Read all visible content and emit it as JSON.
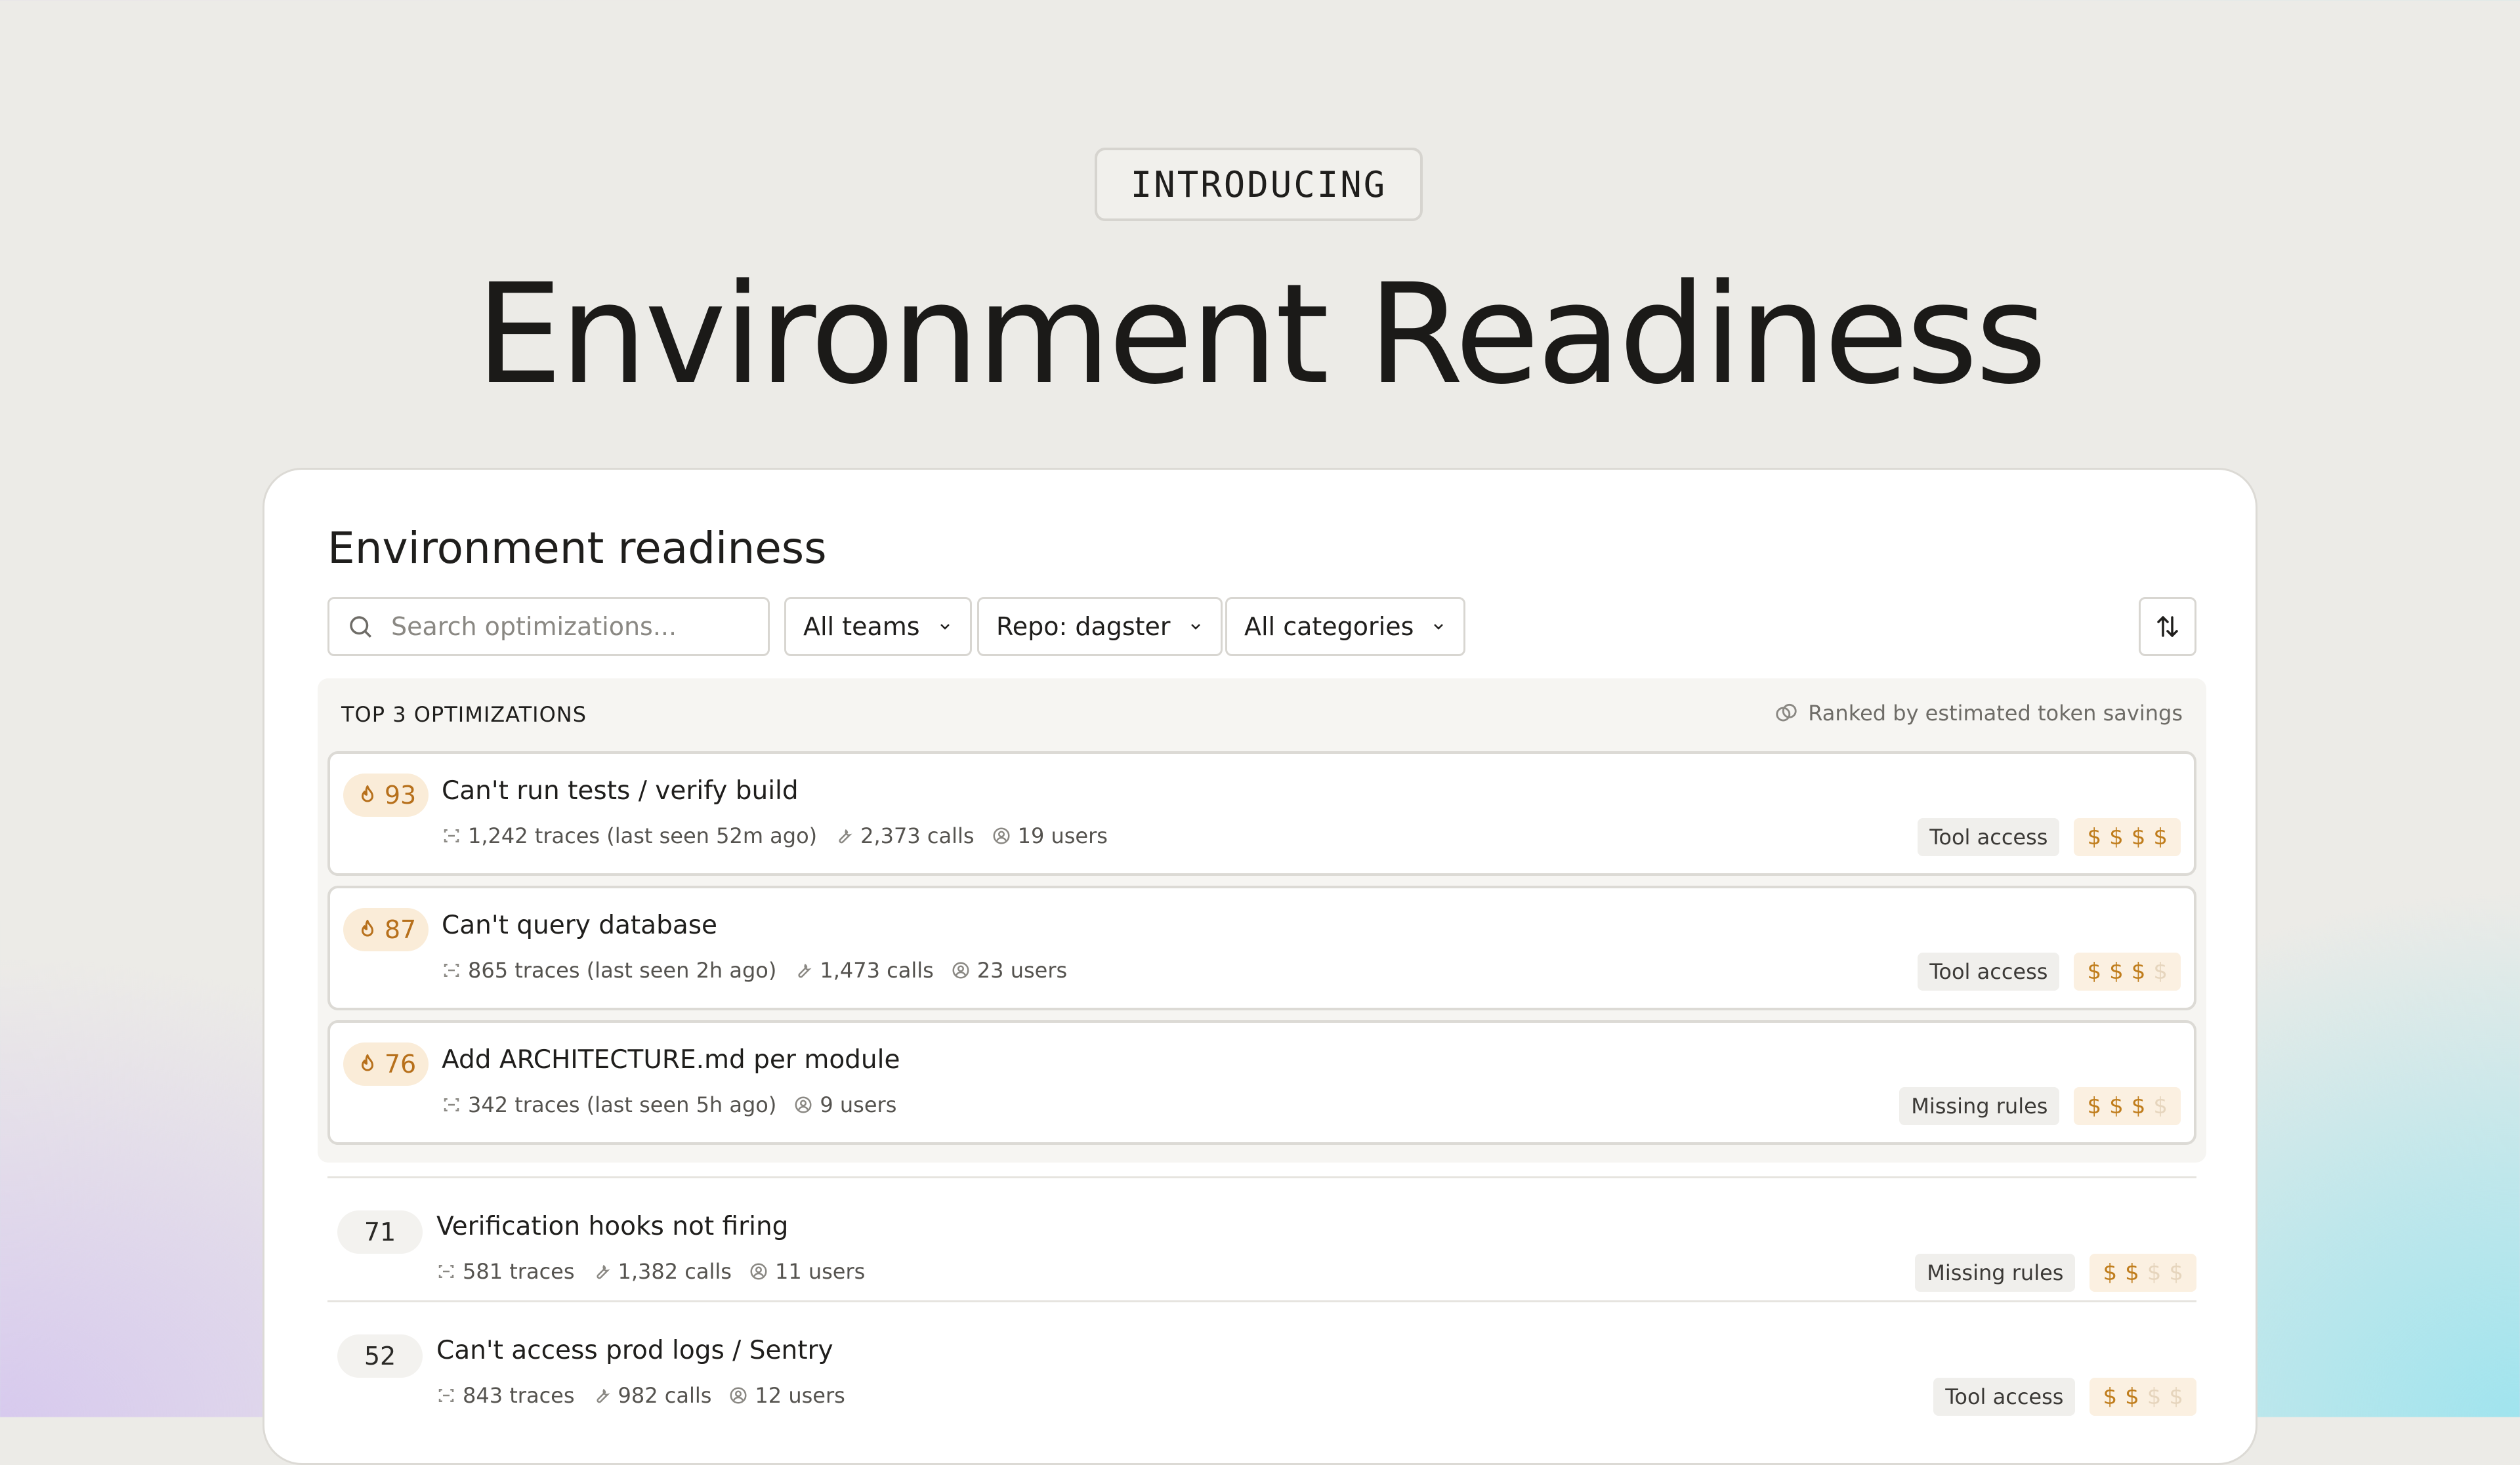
{
  "hero": {
    "badge": "INTRODUCING",
    "title": "Environment Readiness"
  },
  "panel": {
    "title": "Environment readiness",
    "search": {
      "placeholder": "Search optimizations...",
      "value": ""
    },
    "filters": {
      "team": "All teams",
      "repo": "Repo: dagster",
      "category": "All categories"
    },
    "sort_icon": "sort-arrows-icon"
  },
  "top": {
    "header": "TOP 3 OPTIMIZATIONS",
    "ranked_note": "Ranked by estimated token savings",
    "items": [
      {
        "score": "93",
        "title": "Can't run tests / verify build",
        "traces": "1,242 traces (last seen 52m ago)",
        "calls": "2,373 calls",
        "users": "19 users",
        "category": "Tool access",
        "cost_level": 4
      },
      {
        "score": "87",
        "title": "Can't query database",
        "traces": "865 traces (last seen 2h ago)",
        "calls": "1,473 calls",
        "users": "23 users",
        "category": "Tool access",
        "cost_level": 3
      },
      {
        "score": "76",
        "title": "Add ARCHITECTURE.md per module",
        "traces": "342 traces (last seen 5h ago)",
        "users": "9 users",
        "category": "Missing rules",
        "cost_level": 3
      }
    ]
  },
  "rest": {
    "items": [
      {
        "score": "71",
        "title": "Verification hooks not firing",
        "traces": "581 traces",
        "calls": "1,382 calls",
        "users": "11 users",
        "category": "Missing rules",
        "cost_level": 2
      },
      {
        "score": "52",
        "title": "Can't access prod logs / Sentry",
        "traces": "843 traces",
        "calls": "982 calls",
        "users": "12 users",
        "category": "Tool access",
        "cost_level": 2
      }
    ]
  },
  "cost_symbol": "$",
  "colors": {
    "accent": "#c07d1c",
    "accent_muted": "#e6d5bd",
    "score_hot_bg": "#faecd8"
  }
}
